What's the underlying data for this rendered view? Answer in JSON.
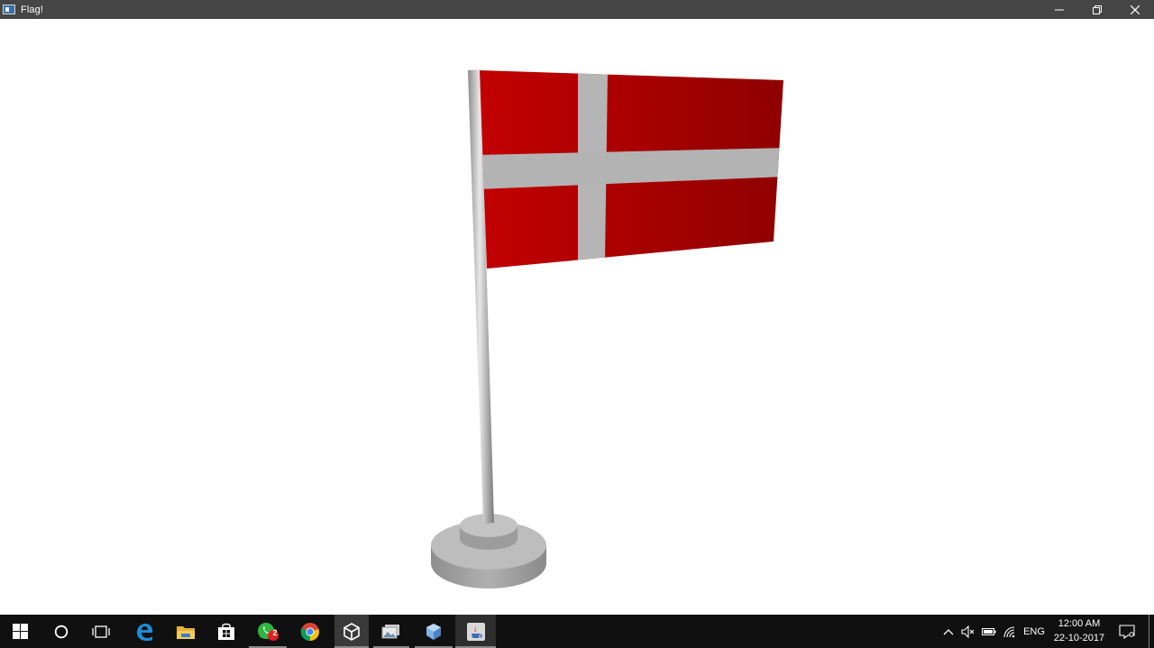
{
  "window": {
    "title": "Flag!",
    "controls": [
      "minimize",
      "restore",
      "close"
    ]
  },
  "scene": {
    "flag": "Danish flag on a pole with a round stand",
    "colors": {
      "red": "#c40000",
      "cross": "#b3b3b3",
      "pole": "#bdbdbd",
      "base": "#a9a9a9"
    }
  },
  "taskbar": {
    "pinned": [
      {
        "name": "start-icon"
      },
      {
        "name": "cortana-icon"
      },
      {
        "name": "task-view-icon"
      },
      {
        "name": "edge-icon"
      },
      {
        "name": "file-explorer-icon"
      },
      {
        "name": "store-icon"
      },
      {
        "name": "whatsapp-icon",
        "badge": "2"
      },
      {
        "name": "chrome-icon"
      },
      {
        "name": "unity-icon"
      },
      {
        "name": "photos-icon"
      },
      {
        "name": "virtualbox-icon"
      },
      {
        "name": "java-icon"
      }
    ],
    "tray": {
      "language": "ENG",
      "time": "12:00 AM",
      "date": "22-10-2017"
    }
  }
}
